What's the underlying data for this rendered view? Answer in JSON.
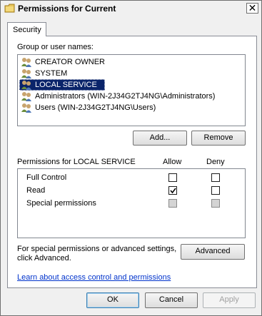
{
  "window": {
    "title": "Permissions for Current"
  },
  "tabs": [
    {
      "label": "Security"
    }
  ],
  "groups": {
    "label": "Group or user names:",
    "items": [
      {
        "label": "CREATOR OWNER",
        "selected": false
      },
      {
        "label": "SYSTEM",
        "selected": false
      },
      {
        "label": "LOCAL SERVICE",
        "selected": true
      },
      {
        "label": "Administrators (WIN-2J34G2TJ4NG\\Administrators)",
        "selected": false
      },
      {
        "label": "Users (WIN-2J34G2TJ4NG\\Users)",
        "selected": false
      }
    ],
    "add_label": "Add...",
    "remove_label": "Remove"
  },
  "permissions": {
    "label": "Permissions for LOCAL SERVICE",
    "allow_header": "Allow",
    "deny_header": "Deny",
    "rows": [
      {
        "label": "Full Control",
        "allow": false,
        "deny": false,
        "disabled": false
      },
      {
        "label": "Read",
        "allow": true,
        "deny": false,
        "disabled": false
      },
      {
        "label": "Special permissions",
        "allow": false,
        "deny": false,
        "disabled": true
      }
    ]
  },
  "advanced": {
    "text_line1": "For special permissions or advanced settings,",
    "text_line2": "click Advanced.",
    "button_label": "Advanced"
  },
  "help_link": "Learn about access control and permissions",
  "footer": {
    "ok_label": "OK",
    "cancel_label": "Cancel",
    "apply_label": "Apply"
  }
}
